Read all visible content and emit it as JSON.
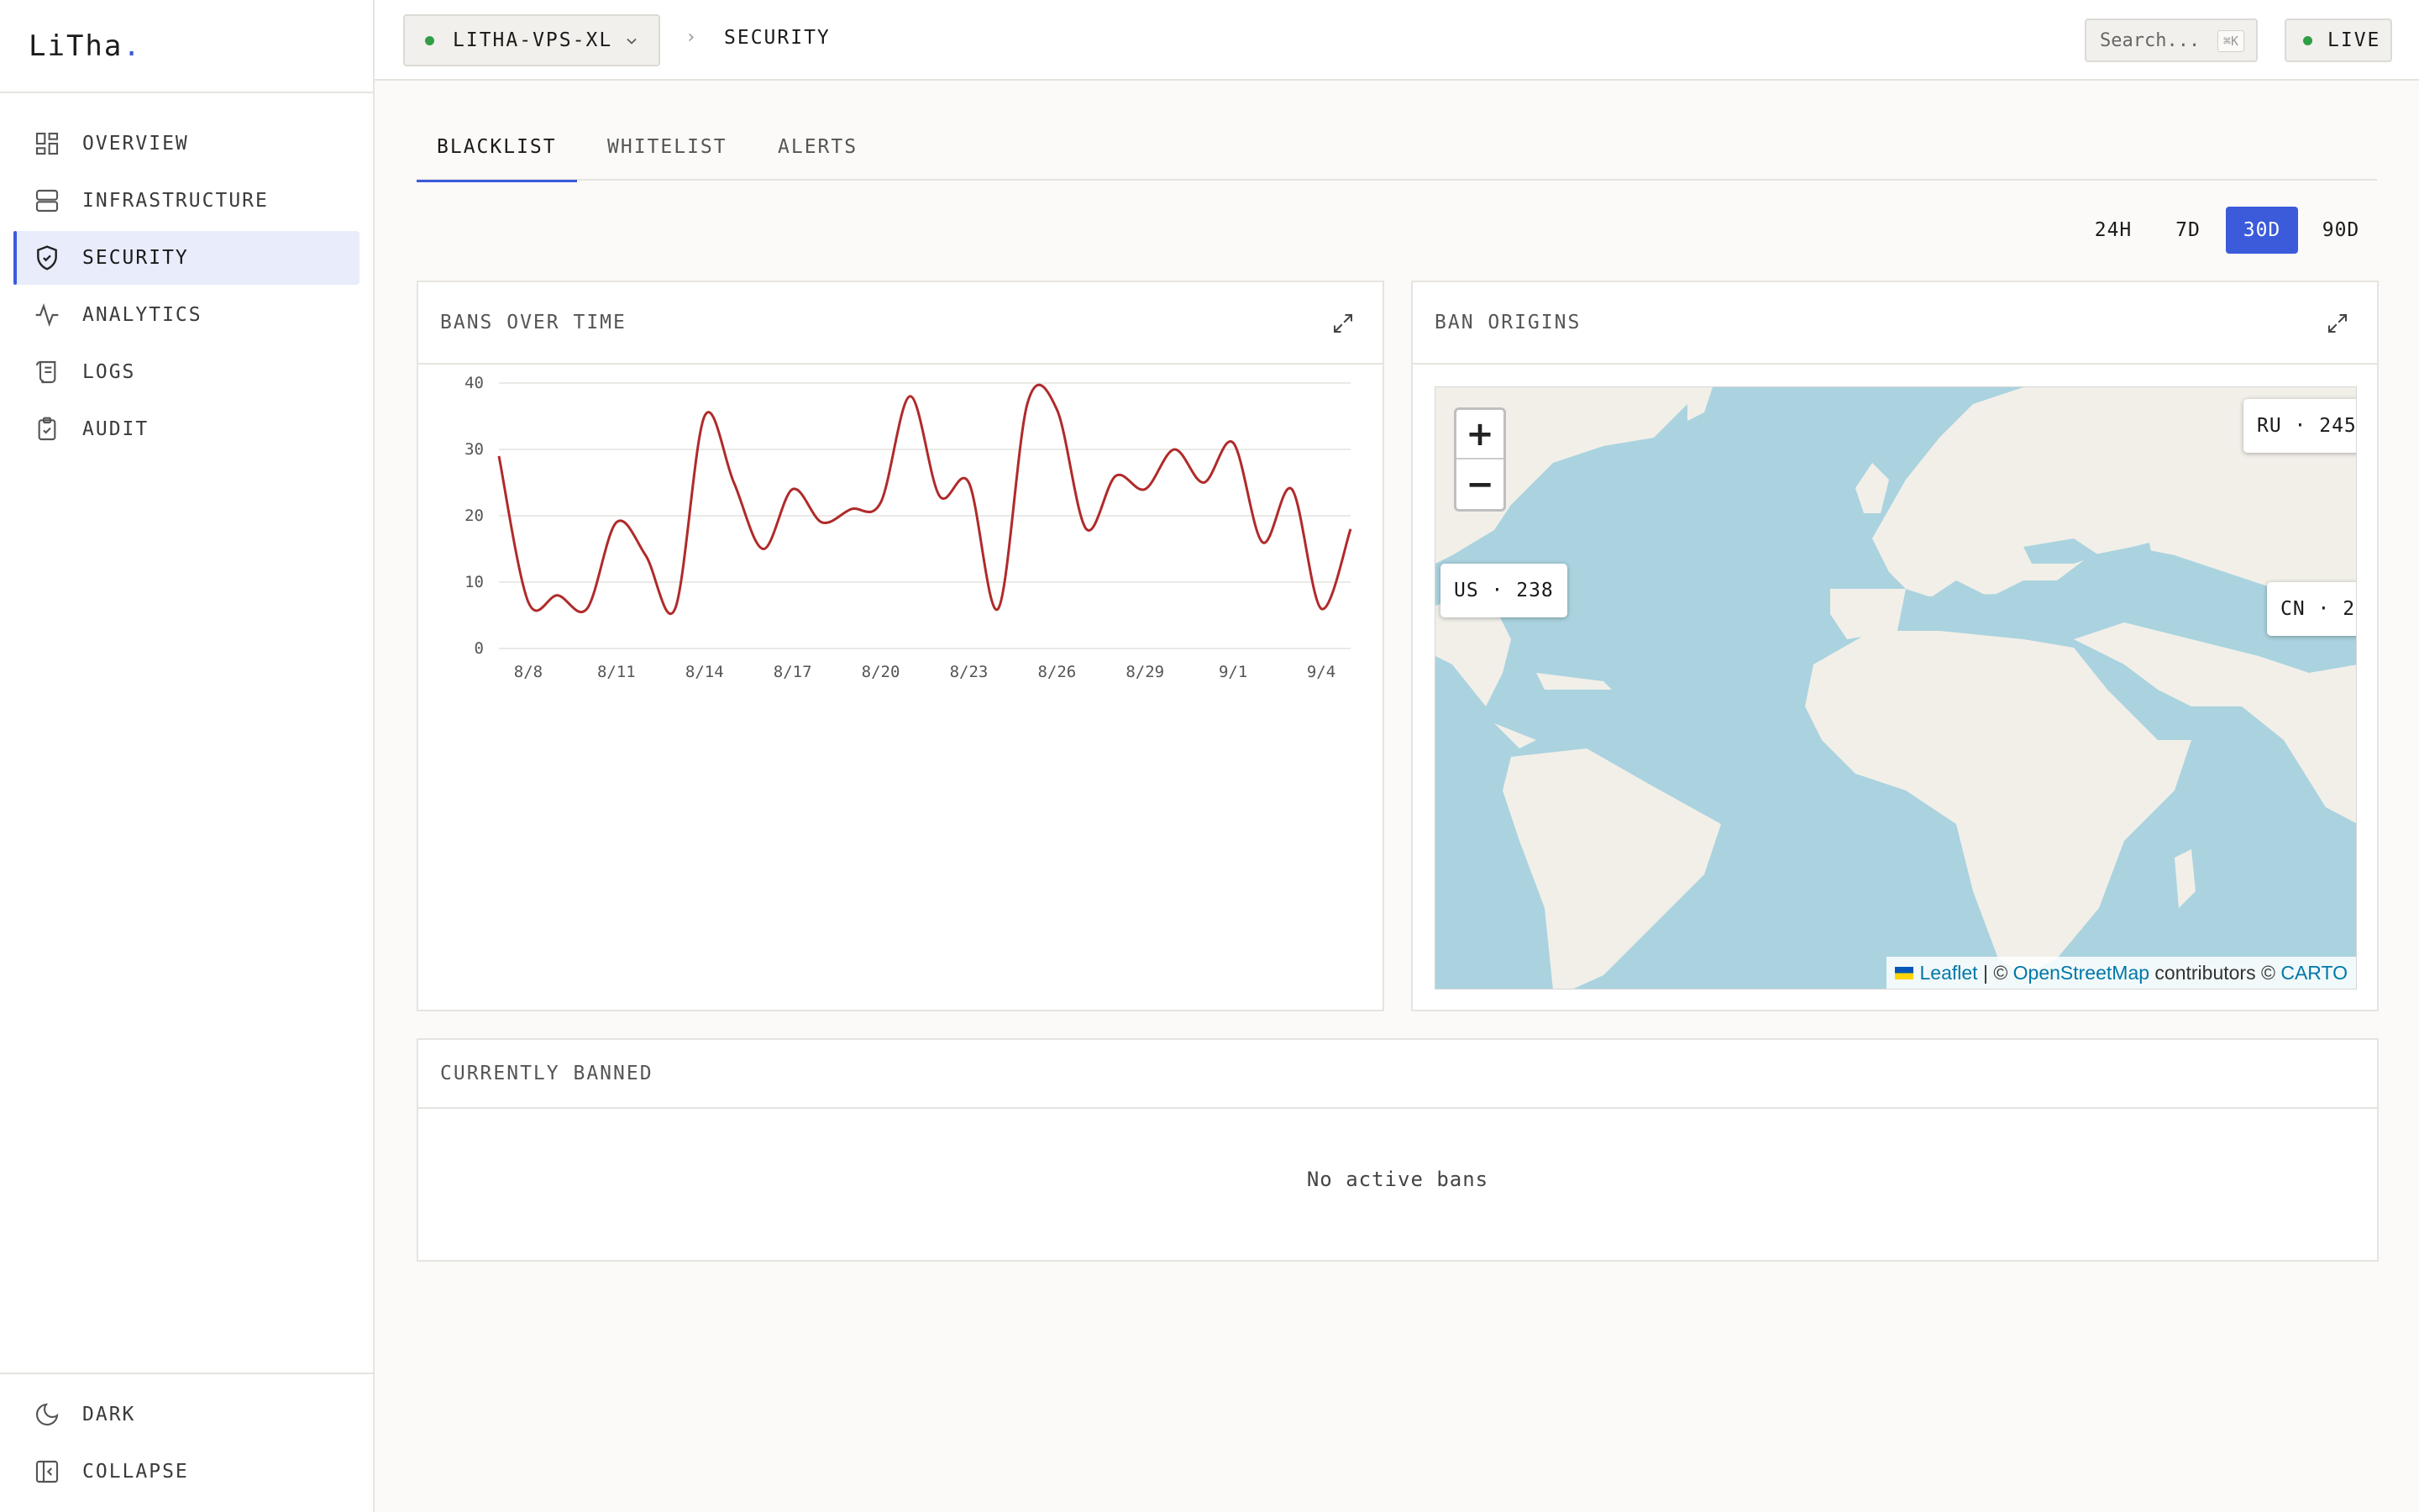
{
  "brand": {
    "name": "LiTha",
    "dot": ".",
    "accent": "#3b5bdb"
  },
  "sidebar": {
    "items": [
      {
        "label": "OVERVIEW",
        "icon": "grid-icon"
      },
      {
        "label": "INFRASTRUCTURE",
        "icon": "server-icon"
      },
      {
        "label": "SECURITY",
        "icon": "shield-icon",
        "active": true
      },
      {
        "label": "ANALYTICS",
        "icon": "activity-icon"
      },
      {
        "label": "LOGS",
        "icon": "scroll-icon"
      },
      {
        "label": "AUDIT",
        "icon": "clipboard-check-icon"
      }
    ],
    "bottom": [
      {
        "label": "DARK",
        "icon": "moon-icon"
      },
      {
        "label": "COLLAPSE",
        "icon": "collapse-icon"
      }
    ]
  },
  "topbar": {
    "server": "LITHA-VPS-XL",
    "breadcrumb_sep": "›",
    "breadcrumb": "SECURITY",
    "search_placeholder": "Search...",
    "search_shortcut": "⌘K",
    "live_label": "LIVE",
    "status_color": "#2f9e44"
  },
  "tabs": [
    {
      "label": "BLACKLIST",
      "active": true
    },
    {
      "label": "WHITELIST"
    },
    {
      "label": "ALERTS"
    }
  ],
  "ranges": [
    {
      "label": "24H"
    },
    {
      "label": "7D"
    },
    {
      "label": "30D",
      "active": true
    },
    {
      "label": "90D"
    }
  ],
  "bans_card": {
    "title": "BANS OVER TIME"
  },
  "origins_card": {
    "title": "BAN ORIGINS",
    "zoom_in": "+",
    "zoom_out": "−",
    "markers": [
      {
        "label": "RU · 245"
      },
      {
        "label": "US · 238"
      },
      {
        "label": "CN · 2"
      }
    ],
    "attribution": {
      "leaflet": "Leaflet",
      "sep": " | © ",
      "osm": "OpenStreetMap",
      "contrib": " contributors © ",
      "carto": "CARTO"
    }
  },
  "banned_card": {
    "title": "CURRENTLY BANNED",
    "empty": "No active bans"
  },
  "chart_data": {
    "type": "line",
    "title": "BANS OVER TIME",
    "color": "#b02a2a",
    "x": [
      "8/7",
      "8/8",
      "8/9",
      "8/10",
      "8/11",
      "8/12",
      "8/13",
      "8/14",
      "8/15",
      "8/16",
      "8/17",
      "8/18",
      "8/19",
      "8/20",
      "8/21",
      "8/22",
      "8/23",
      "8/24",
      "8/25",
      "8/26",
      "8/27",
      "8/28",
      "8/29",
      "8/30",
      "8/31",
      "9/1",
      "9/2",
      "9/3",
      "9/4"
    ],
    "values": [
      29,
      7,
      8,
      6,
      19,
      14,
      6,
      35,
      25,
      15,
      24,
      19,
      21,
      22,
      38,
      23,
      25,
      6,
      37,
      36,
      18,
      26,
      24,
      30,
      25,
      31,
      16,
      24,
      6,
      18
    ],
    "x_ticks": [
      "8/8",
      "8/11",
      "8/14",
      "8/17",
      "8/20",
      "8/23",
      "8/26",
      "8/29",
      "9/1",
      "9/4"
    ],
    "y_ticks": [
      0,
      10,
      20,
      30,
      40
    ],
    "ylim": [
      0,
      40
    ],
    "grid": true
  }
}
